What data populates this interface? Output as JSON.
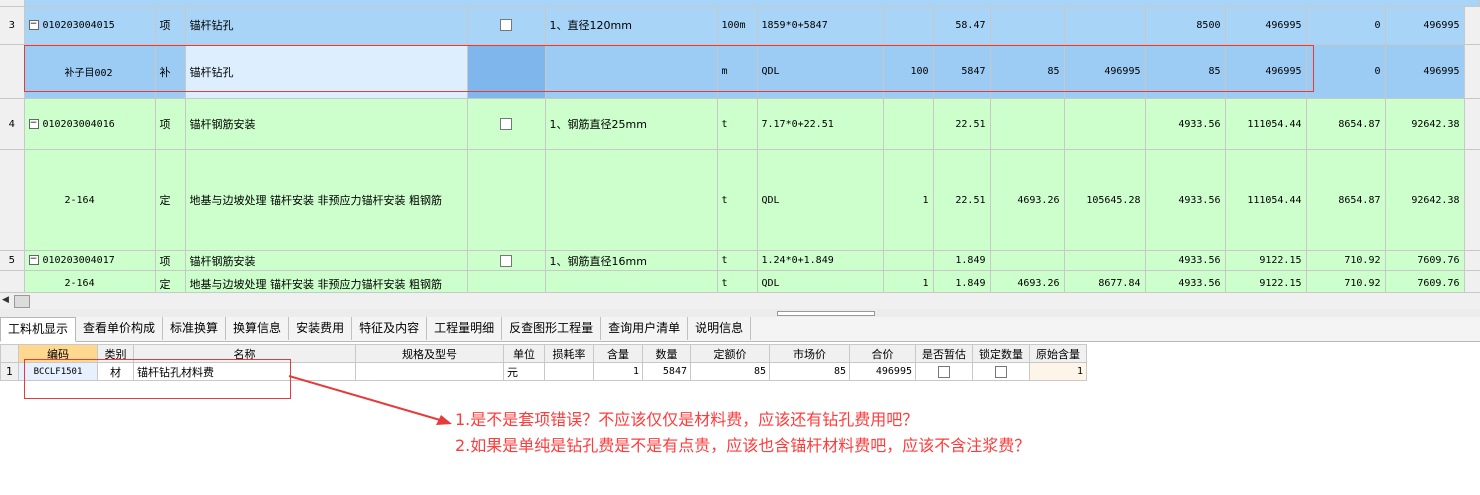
{
  "main_grid": {
    "rows": [
      {
        "row_no": "3",
        "code": "010203004015",
        "type": "项",
        "name": "锚杆钻孔",
        "feature": "1、直径120mm",
        "unit": "100m",
        "formula": "1859*0+5847",
        "c1": "",
        "qty": "58.47",
        "c2": "",
        "c3": "",
        "unit_price": "8500",
        "total": "496995",
        "c4": "0",
        "c5": "496995"
      },
      {
        "row_no": "",
        "code": "补子目002",
        "type": "补",
        "name": "锚杆钻孔",
        "feature": "",
        "unit": "m",
        "formula": "QDL",
        "c1": "100",
        "qty": "5847",
        "c2": "85",
        "c3": "496995",
        "unit_price": "85",
        "total": "496995",
        "c4": "0",
        "c5": "496995"
      },
      {
        "row_no": "4",
        "code": "010203004016",
        "type": "项",
        "name": "锚杆钢筋安装",
        "feature": "1、钢筋直径25mm",
        "unit": "t",
        "formula": "7.17*0+22.51",
        "c1": "",
        "qty": "22.51",
        "c2": "",
        "c3": "",
        "unit_price": "4933.56",
        "total": "111054.44",
        "c4": "8654.87",
        "c5": "92642.38"
      },
      {
        "row_no": "",
        "code": "2-164",
        "type": "定",
        "name": "地基与边坡处理 锚杆安装 非预应力锚杆安装 粗钢筋",
        "feature": "",
        "unit": "t",
        "formula": "QDL",
        "c1": "1",
        "qty": "22.51",
        "c2": "4693.26",
        "c3": "105645.28",
        "unit_price": "4933.56",
        "total": "111054.44",
        "c4": "8654.87",
        "c5": "92642.38"
      },
      {
        "row_no": "5",
        "code": "010203004017",
        "type": "项",
        "name": "锚杆钢筋安装",
        "feature": "1、钢筋直径16mm",
        "unit": "t",
        "formula": "1.24*0+1.849",
        "c1": "",
        "qty": "1.849",
        "c2": "",
        "c3": "",
        "unit_price": "4933.56",
        "total": "9122.15",
        "c4": "710.92",
        "c5": "7609.76"
      },
      {
        "row_no": "",
        "code": "2-164",
        "type": "定",
        "name": "地基与边坡处理 锚杆安装 非预应力锚杆安装 粗钢筋",
        "feature": "",
        "unit": "t",
        "formula": "QDL",
        "c1": "1",
        "qty": "1.849",
        "c2": "4693.26",
        "c3": "8677.84",
        "unit_price": "4933.56",
        "total": "9122.15",
        "c4": "710.92",
        "c5": "7609.76"
      }
    ]
  },
  "tabs": [
    "工料机显示",
    "查看单价构成",
    "标准换算",
    "换算信息",
    "安装费用",
    "特征及内容",
    "工程量明细",
    "反查图形工程量",
    "查询用户清单",
    "说明信息"
  ],
  "detail": {
    "headers": [
      "编码",
      "类别",
      "名称",
      "规格及型号",
      "单位",
      "损耗率",
      "含量",
      "数量",
      "定额价",
      "市场价",
      "合价",
      "是否暂估",
      "锁定数量",
      "原始含量"
    ],
    "row": {
      "row_no": "1",
      "code": "BCCLF1501",
      "category": "材",
      "name": "锚杆钻孔材料费",
      "spec": "",
      "unit": "元",
      "loss": "",
      "content": "1",
      "qty": "5847",
      "quota_price": "85",
      "market_price": "85",
      "total": "496995",
      "orig_content": "1"
    }
  },
  "annotations": {
    "note1": "1.是不是套项错误？不应该仅仅是材料费，应该还有钻孔费用吧？",
    "note2": "2.如果是单纯是钻孔费是不是有点贵，应该也含锚杆材料费吧，应该不含注浆费？"
  },
  "colors": {
    "item_row": "#a8d4f8",
    "sub_row": "#9ccbf3",
    "green_row": "#ccffcc",
    "annotation": "#ff3b3b"
  }
}
